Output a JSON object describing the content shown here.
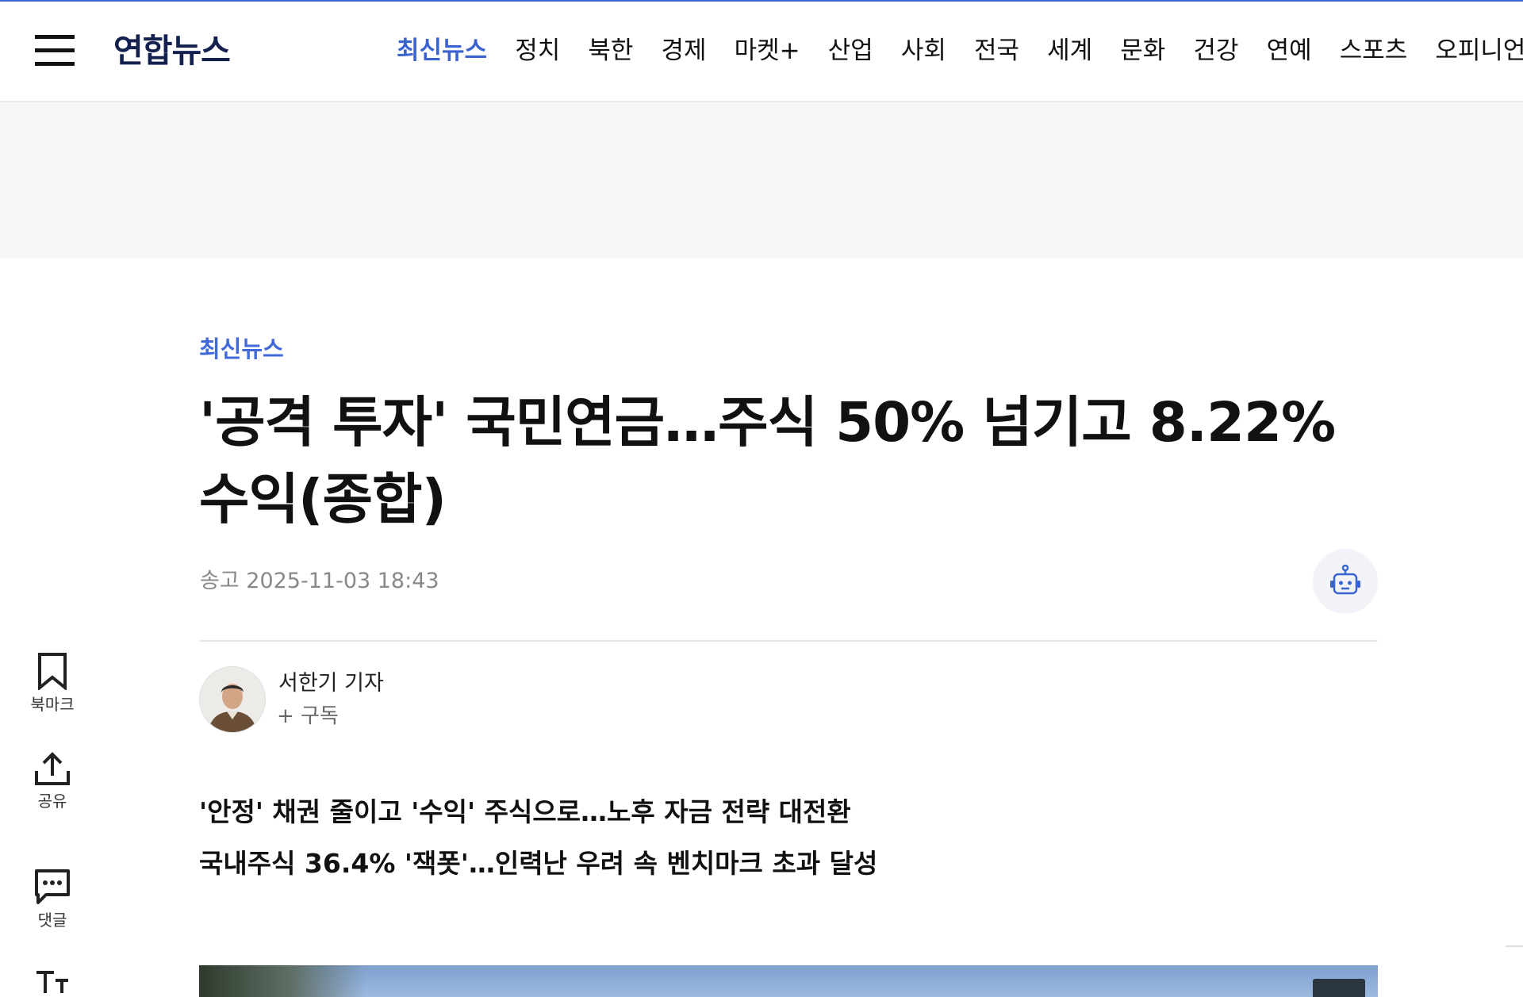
{
  "header": {
    "logo": "연합뉴스",
    "nav_items": [
      {
        "label": "최신뉴스",
        "active": true
      },
      {
        "label": "정치"
      },
      {
        "label": "북한"
      },
      {
        "label": "경제"
      },
      {
        "label": "마켓+"
      },
      {
        "label": "산업"
      },
      {
        "label": "사회"
      },
      {
        "label": "전국"
      },
      {
        "label": "세계"
      },
      {
        "label": "문화"
      },
      {
        "label": "건강"
      },
      {
        "label": "연예"
      },
      {
        "label": "스포츠"
      },
      {
        "label": "오피니언"
      }
    ]
  },
  "article": {
    "category": "최신뉴스",
    "headline": "'공격 투자' 국민연금…주식 50% 넘기고 8.22% 수익(종합)",
    "sent_time": "송고 2025-11-03 18:43",
    "reporter": {
      "name": "서한기 기자",
      "subscribe_label": "+ 구독"
    },
    "subheads": [
      "'안정' 채권 줄이고 '수익' 주식으로…노후 자금 전략 대전환",
      "국내주식 36.4% '잭폿'…인력난 우려 속 벤치마크 초과 달성"
    ]
  },
  "side_toolbar": {
    "bookmark_label": "북마크",
    "share_label": "공유",
    "comment_label": "댓글"
  },
  "colors": {
    "accent": "#3b63cf",
    "logo": "#14214f",
    "text": "#111111",
    "muted": "#888888"
  },
  "icons": [
    "hamburger-menu-icon",
    "robot-icon",
    "bookmark-icon",
    "share-icon",
    "comment-icon",
    "font-size-icon"
  ]
}
